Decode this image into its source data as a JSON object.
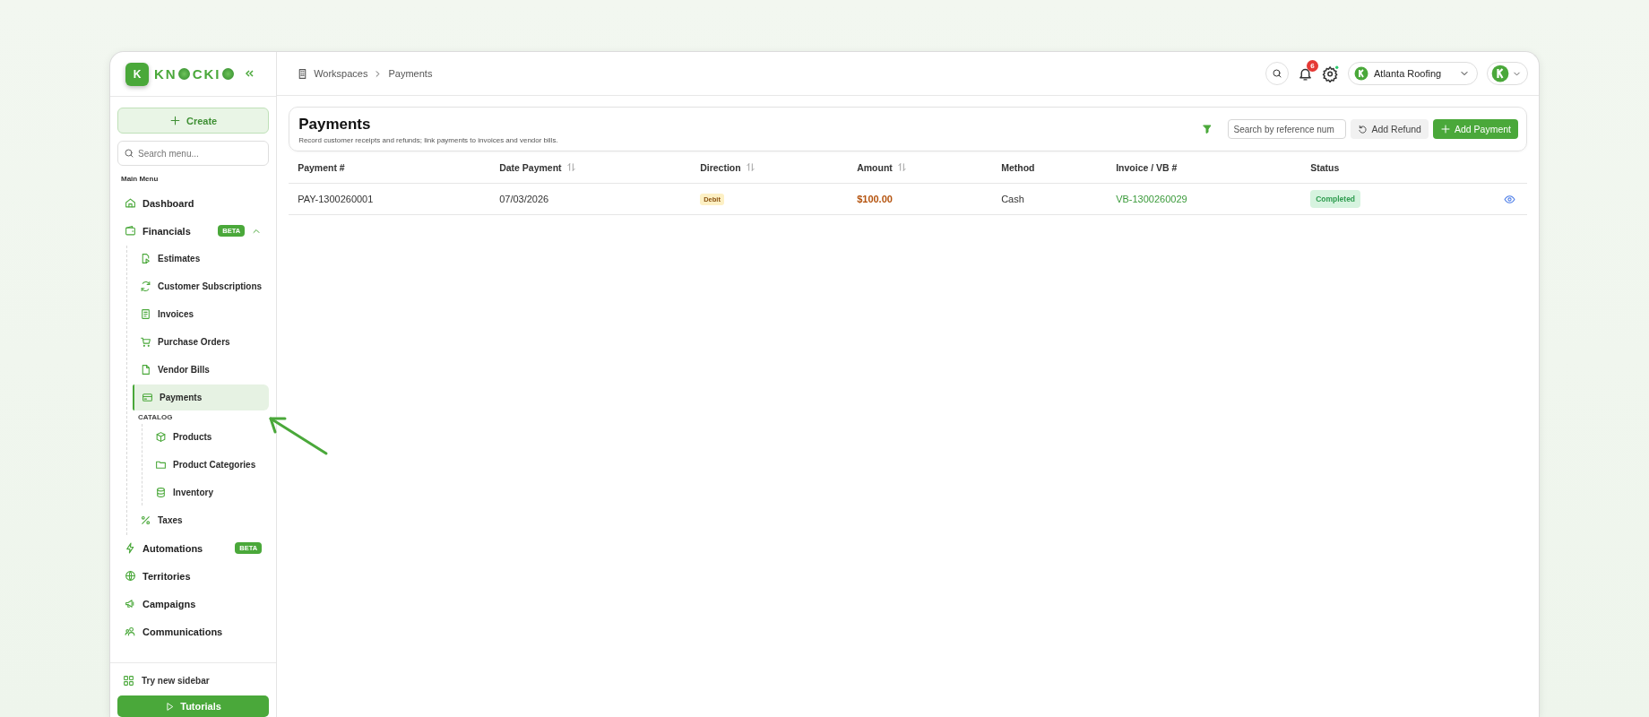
{
  "logo": {
    "badge": "K",
    "wordmark_parts": [
      "KN",
      "CKI"
    ]
  },
  "sidebar": {
    "create_button": "Create",
    "search": {
      "placeholder": "Search menu..."
    },
    "section_title": "Main Menu",
    "items": [
      {
        "label": "Dashboard",
        "selected": false
      },
      {
        "label": "Financials",
        "selected": false,
        "badge": "BETA",
        "expanded": true,
        "children": [
          {
            "label": "Estimates",
            "selected": false
          },
          {
            "label": "Customer Subscriptions",
            "selected": false
          },
          {
            "label": "Invoices",
            "selected": false
          },
          {
            "label": "Purchase Orders",
            "selected": false
          },
          {
            "label": "Vendor Bills",
            "selected": false
          },
          {
            "label": "Payments",
            "selected": true
          },
          {
            "kind": "section",
            "label": "CATALOG",
            "children": [
              {
                "label": "Products",
                "selected": false
              },
              {
                "label": "Product Categories",
                "selected": false
              },
              {
                "label": "Inventory",
                "selected": false
              }
            ]
          },
          {
            "label": "Taxes",
            "selected": false
          }
        ]
      },
      {
        "label": "Automations",
        "selected": false,
        "badge": "BETA"
      },
      {
        "label": "Territories",
        "selected": false
      },
      {
        "label": "Campaigns",
        "selected": false
      },
      {
        "label": "Communications",
        "selected": false
      }
    ],
    "footer": {
      "link": "Try new sidebar",
      "button": "Tutorials"
    }
  },
  "topbar": {
    "breadcrumb": [
      "Workspaces",
      "Payments"
    ],
    "notification_count": "6",
    "workspace": "Atlanta Roofing"
  },
  "page": {
    "title": "Payments",
    "subtitle": "Record customer receipts and refunds; link payments to invoices and vendor bills.",
    "search": {
      "placeholder": "Search by reference num"
    },
    "buttons": [
      {
        "kind": "secondary",
        "label": "Add Refund"
      },
      {
        "kind": "primary",
        "label": "Add Payment"
      }
    ]
  },
  "table": {
    "columns": [
      {
        "label": "Payment #",
        "sortable": false
      },
      {
        "label": "Date Payment",
        "sortable": true
      },
      {
        "label": "Direction",
        "sortable": true
      },
      {
        "label": "Amount",
        "sortable": true
      },
      {
        "label": "Method",
        "sortable": false
      },
      {
        "label": "Invoice / VB #",
        "sortable": false
      },
      {
        "label": "Status",
        "sortable": false
      }
    ],
    "rows": [
      {
        "cells": [
          {
            "kind": "text",
            "text": "PAY-1300260001"
          },
          {
            "kind": "text",
            "text": "07/03/2026"
          },
          {
            "kind": "tag",
            "text": "Debit"
          },
          {
            "kind": "amount",
            "text": "$100.00"
          },
          {
            "kind": "text",
            "text": "Cash"
          },
          {
            "kind": "link",
            "text": "VB-1300260029"
          },
          {
            "kind": "status",
            "text": "Completed"
          }
        ]
      }
    ]
  }
}
